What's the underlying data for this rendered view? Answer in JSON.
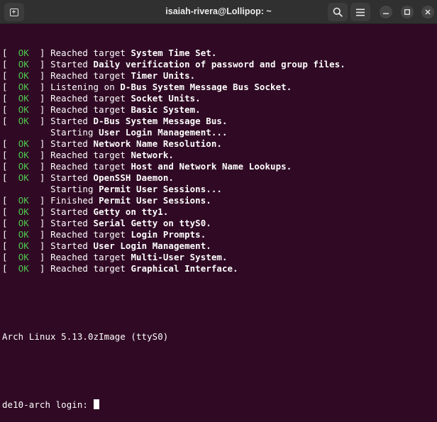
{
  "window": {
    "title": "isaiah-rivera@Lollipop: ~",
    "icons": {
      "new_tab": "new-tab-icon",
      "search": "search-icon",
      "menu": "hamburger-menu-icon",
      "minimize": "minimize-icon",
      "maximize": "maximize-icon",
      "close": "close-icon"
    }
  },
  "colors": {
    "background": "#300a24",
    "ok": "#4ec94e",
    "text": "#ffffff",
    "titlebar": "#303030"
  },
  "boot_lines": [
    {
      "status": "OK",
      "action": "Reached target",
      "unit": "System Time Set."
    },
    {
      "status": "OK",
      "action": "Started",
      "unit": "Daily verification of password and group files."
    },
    {
      "status": "OK",
      "action": "Reached target",
      "unit": "Timer Units."
    },
    {
      "status": "OK",
      "action": "Listening on",
      "unit": "D-Bus System Message Bus Socket."
    },
    {
      "status": "OK",
      "action": "Reached target",
      "unit": "Socket Units."
    },
    {
      "status": "OK",
      "action": "Reached target",
      "unit": "Basic System."
    },
    {
      "status": "OK",
      "action": "Started",
      "unit": "D-Bus System Message Bus."
    },
    {
      "status": "",
      "action": "Starting",
      "unit": "User Login Management..."
    },
    {
      "status": "OK",
      "action": "Started",
      "unit": "Network Name Resolution."
    },
    {
      "status": "OK",
      "action": "Reached target",
      "unit": "Network."
    },
    {
      "status": "OK",
      "action": "Reached target",
      "unit": "Host and Network Name Lookups."
    },
    {
      "status": "OK",
      "action": "Started",
      "unit": "OpenSSH Daemon."
    },
    {
      "status": "",
      "action": "Starting",
      "unit": "Permit User Sessions..."
    },
    {
      "status": "OK",
      "action": "Finished",
      "unit": "Permit User Sessions."
    },
    {
      "status": "OK",
      "action": "Started",
      "unit": "Getty on tty1."
    },
    {
      "status": "OK",
      "action": "Started",
      "unit": "Serial Getty on ttyS0."
    },
    {
      "status": "OK",
      "action": "Reached target",
      "unit": "Login Prompts."
    },
    {
      "status": "OK",
      "action": "Started",
      "unit": "User Login Management."
    },
    {
      "status": "OK",
      "action": "Reached target",
      "unit": "Multi-User System."
    },
    {
      "status": "OK",
      "action": "Reached target",
      "unit": "Graphical Interface."
    }
  ],
  "banner": "Arch Linux 5.13.0zImage (ttyS0)",
  "login_prompt": "de10-arch login: "
}
